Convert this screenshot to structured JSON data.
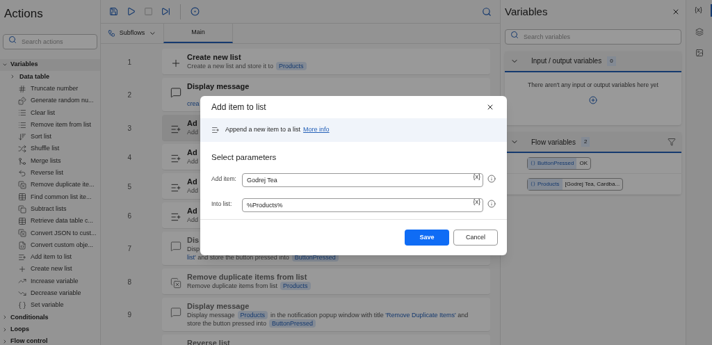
{
  "actions_panel": {
    "title": "Actions",
    "search": {
      "placeholder": "Search actions"
    },
    "groups": [
      {
        "label": "Variables",
        "expanded": true,
        "children": [
          {
            "label": "Data table",
            "expanded": false,
            "kind": "folder"
          },
          {
            "label": "Truncate number",
            "kind": "number"
          },
          {
            "label": "Generate random nu...",
            "kind": "random"
          },
          {
            "label": "Clear list",
            "kind": "list"
          },
          {
            "label": "Remove item from list",
            "kind": "list"
          },
          {
            "label": "Sort list",
            "kind": "sort"
          },
          {
            "label": "Shuffle list",
            "kind": "shuffle"
          },
          {
            "label": "Merge lists",
            "kind": "merge"
          },
          {
            "label": "Reverse list",
            "kind": "reverse"
          },
          {
            "label": "Remove duplicate ite...",
            "kind": "dedupe"
          },
          {
            "label": "Find common list ite...",
            "kind": "table"
          },
          {
            "label": "Subtract lists",
            "kind": "copy"
          },
          {
            "label": "Retrieve data table c...",
            "kind": "table"
          },
          {
            "label": "Convert JSON to cust...",
            "kind": "dedupe"
          },
          {
            "label": "Convert custom obje...",
            "kind": "file"
          },
          {
            "label": "Add item to list",
            "kind": "addlist"
          },
          {
            "label": "Create new list",
            "kind": "plus"
          },
          {
            "label": "Increase variable",
            "kind": "up"
          },
          {
            "label": "Decrease variable",
            "kind": "down"
          },
          {
            "label": "Set variable",
            "kind": "var"
          }
        ]
      },
      {
        "label": "Conditionals",
        "expanded": false
      },
      {
        "label": "Loops",
        "expanded": false
      },
      {
        "label": "Flow control",
        "expanded": false
      }
    ]
  },
  "toolbar": [
    {
      "kind": "save",
      "disabled": false
    },
    {
      "kind": "run",
      "disabled": false
    },
    {
      "kind": "stop",
      "disabled": true
    },
    {
      "kind": "step",
      "disabled": false
    },
    {
      "kind": "record",
      "disabled": false
    }
  ],
  "tabs": {
    "subflows": "Subflows",
    "items": [
      {
        "label": "Main",
        "selected": true
      }
    ]
  },
  "steps": [
    {
      "number": "1",
      "kind": "plus",
      "selected": false,
      "disabled": false,
      "title": "Create new list",
      "lines": [
        [
          {
            "t": "Create a new list and store it to",
            "kind": "plain"
          },
          {
            "t": "Products",
            "kind": "variable"
          }
        ]
      ]
    },
    {
      "number": "2",
      "kind": "message",
      "selected": false,
      "disabled": false,
      "title": "Display message",
      "lines": [
        [
          {
            "t": "crea",
            "kind": "string"
          }
        ]
      ],
      "hidden_line": true
    },
    {
      "number": "3",
      "kind": "addlist",
      "selected": true,
      "disabled": false,
      "title": "Ad",
      "lines": [
        [
          {
            "t": "Add",
            "kind": "plain"
          }
        ]
      ]
    },
    {
      "number": "4",
      "kind": "addlist",
      "selected": false,
      "disabled": false,
      "title": "Ad",
      "lines": [
        [
          {
            "t": "Add",
            "kind": "plain"
          }
        ]
      ]
    },
    {
      "number": "5",
      "kind": "addlist",
      "selected": false,
      "disabled": false,
      "title": "Ad",
      "lines": [
        [
          {
            "t": "Add",
            "kind": "plain"
          }
        ]
      ]
    },
    {
      "number": "6",
      "kind": "addlist",
      "selected": false,
      "disabled": false,
      "title": "Ad",
      "lines": [
        [
          {
            "t": "Add",
            "kind": "plain"
          }
        ]
      ]
    },
    {
      "number": "7",
      "kind": "message",
      "selected": false,
      "disabled": true,
      "title": "Dis",
      "lines": [
        [
          {
            "t": "Disp",
            "kind": "plain"
          }
        ],
        [
          {
            "t": "list'",
            "kind": "string"
          },
          {
            "t": "and store the button pressed into",
            "kind": "plain"
          },
          {
            "t": "ButtonPressed",
            "kind": "variable"
          }
        ]
      ]
    },
    {
      "number": "8",
      "kind": "dedupe",
      "selected": false,
      "disabled": true,
      "title": "Remove duplicate items from list",
      "lines": [
        [
          {
            "t": "Remove duplicate items from list",
            "kind": "plain"
          },
          {
            "t": "Products",
            "kind": "variable"
          }
        ]
      ]
    },
    {
      "number": "9",
      "kind": "message",
      "selected": false,
      "disabled": true,
      "title": "Display message",
      "lines": [
        [
          {
            "t": "Display message",
            "kind": "plain"
          },
          {
            "t": "Products",
            "kind": "variable"
          },
          {
            "t": "in the notification popup window with title",
            "kind": "plain"
          },
          {
            "t": "'Remove Duplicate Items'",
            "kind": "string"
          },
          {
            "t": "and",
            "kind": "plain"
          }
        ],
        [
          {
            "t": "store the button pressed into",
            "kind": "plain"
          },
          {
            "t": "ButtonPressed",
            "kind": "variable"
          }
        ]
      ]
    },
    {
      "kind": "reverse",
      "selected": false,
      "disabled": true,
      "title": "Reverse list"
    }
  ],
  "variables_panel": {
    "title": "Variables",
    "search": {
      "placeholder": "Search variables"
    },
    "sections": [
      {
        "title": "Input / output variables",
        "count": "0",
        "expanded": true,
        "filter": false,
        "empty_text": "There aren't any input or output variables here yet"
      },
      {
        "title": "Flow variables",
        "count": "2",
        "expanded": true,
        "filter": true,
        "items": [
          {
            "name": "ButtonPressed",
            "value": "OK"
          },
          {
            "name": "Products",
            "value": "[Godrej Tea, Cardba..."
          }
        ]
      }
    ]
  },
  "side_tabs": [
    {
      "kind": "variables",
      "label": "{x}",
      "selected": true
    },
    {
      "kind": "layers",
      "selected": false
    },
    {
      "kind": "image",
      "selected": false
    }
  ],
  "dialog": {
    "title": "Add item to list",
    "info": "Append a new item to a list",
    "link": "More info",
    "section": "Select parameters",
    "fields": [
      {
        "label": "Add item:",
        "value": "Godrej Tea",
        "var_button": "{x}"
      },
      {
        "label": "Into list:",
        "value": "%Products%",
        "var_button": "{x}"
      }
    ],
    "buttons": [
      {
        "label": "Save",
        "kind": "primary"
      },
      {
        "label": "Cancel",
        "kind": "secondary"
      }
    ]
  }
}
